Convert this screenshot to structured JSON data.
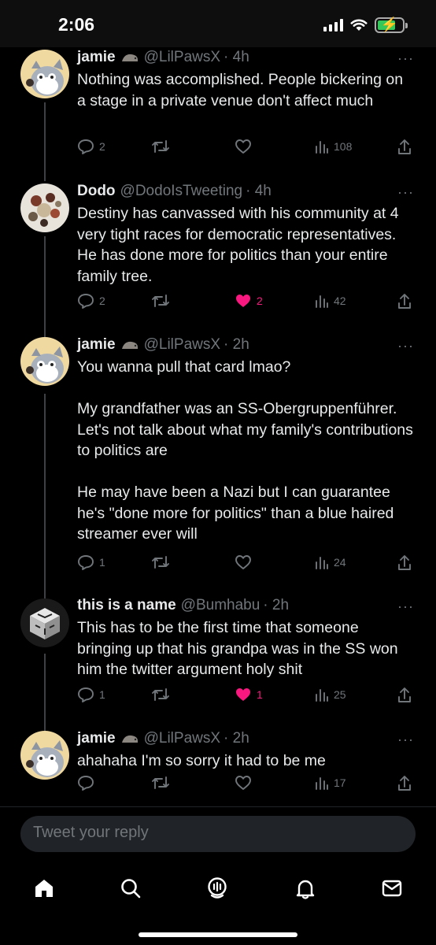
{
  "status_bar": {
    "time": "2:06"
  },
  "tweets": [
    {
      "name": "jamie",
      "handle": "@LilPawsX",
      "time": "· 4h",
      "text": "Nothing was accomplished. People bickering on a stage in a private venue don't affect much",
      "replies": "2",
      "retweets": "",
      "likes": "",
      "views": "108",
      "liked": false
    },
    {
      "name": "Dodo",
      "handle": "@DodoIsTweeting",
      "time": "· 4h",
      "text": "Destiny has canvassed with his community at 4 very tight races for democratic representatives. He has done more for politics than your entire family tree.",
      "replies": "2",
      "retweets": "",
      "likes": "2",
      "views": "42",
      "liked": true
    },
    {
      "name": "jamie",
      "handle": "@LilPawsX",
      "time": "· 2h",
      "text": "You wanna pull that card lmao?\n\nMy grandfather was an SS-Obergruppenführer. Let's not talk about what my family's contributions to politics are\n\nHe may have been a Nazi but I can guarantee he's \"done more for politics\" than a blue haired streamer ever will",
      "replies": "1",
      "retweets": "",
      "likes": "",
      "views": "24",
      "liked": false
    },
    {
      "name": "this is a name",
      "handle": "@Bumhabu",
      "time": "· 2h",
      "text": "This has to be the first time that someone bringing up that his grandpa was in the SS won him the twitter argument holy shit",
      "replies": "1",
      "retweets": "",
      "likes": "1",
      "views": "25",
      "liked": true
    },
    {
      "name": "jamie",
      "handle": "@LilPawsX",
      "time": "· 2h",
      "text": "ahahaha I'm so sorry it had to be me",
      "replies": "",
      "retweets": "",
      "likes": "",
      "views": "17",
      "liked": false
    }
  ],
  "reply_bar": {
    "placeholder": "Tweet your reply"
  },
  "more_label": "···",
  "colors": {
    "background": "#000000",
    "text": "#e7e9ea",
    "muted": "#71767b",
    "like": "#f91880",
    "battery": "#34c759"
  },
  "icons": [
    "home-icon",
    "search-icon",
    "spaces-icon",
    "notifications-icon",
    "messages-icon"
  ]
}
